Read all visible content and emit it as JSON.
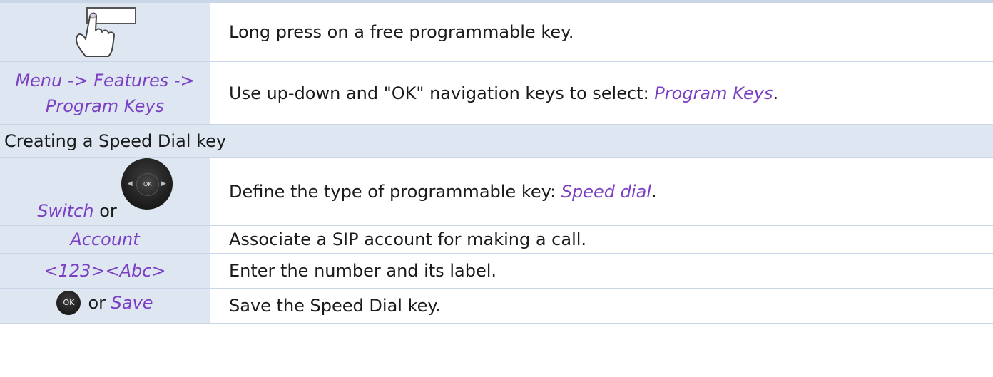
{
  "rows": {
    "long_press": {
      "icon": "hand-pressing-key-icon",
      "text": "Long press on a free programmable key."
    },
    "menu": {
      "path": "Menu -> Features -> Program Keys",
      "text_prefix": "Use up-down and \"OK\" navigation keys to select: ",
      "text_highlight": "Program Keys",
      "text_suffix": "."
    },
    "section_title": "Creating a Speed Dial key",
    "switch": {
      "left_highlight": "Switch",
      "left_or": "or",
      "icon": "navigation-ok-pad-icon",
      "icon_label": "OK",
      "text_prefix": "Define the type of programmable key: ",
      "text_highlight": "Speed dial",
      "text_suffix": "."
    },
    "account": {
      "left": "Account",
      "text": "Associate a SIP account for making a call."
    },
    "entry": {
      "left": "<123><Abc>",
      "text": "Enter the number and its label."
    },
    "save": {
      "icon": "ok-button-icon",
      "icon_label": "OK",
      "left_or": "or",
      "left_highlight": "Save",
      "text": "Save the Speed Dial key."
    }
  },
  "colors": {
    "accent_text": "#7b3fc4",
    "cell_background": "#dde6f1",
    "border": "#c9d6e8"
  }
}
